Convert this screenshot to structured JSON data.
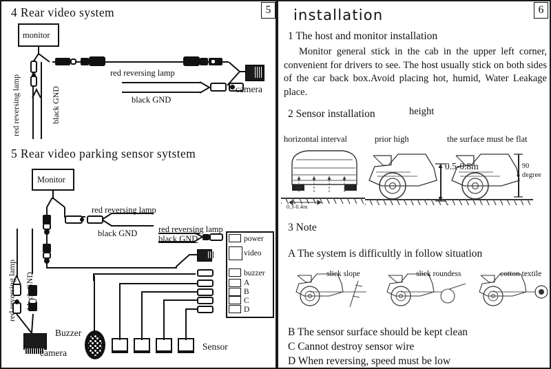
{
  "document": {
    "left_page_number": "5",
    "right_page_number": "6"
  },
  "left_panel": {
    "section4": {
      "heading": "4  Rear  video   system",
      "monitor_label": "monitor",
      "camera_label": "camera",
      "wire_labels": {
        "red_reversing": "red   reversing lamp",
        "black_gnd": "black   GND",
        "vertical_red": "red reversing lamp",
        "vertical_black": "black   GND"
      }
    },
    "section5": {
      "heading": "5  Rear  video  parking  sensor  sytstem",
      "monitor_label": "Monitor",
      "camera_label": "camera",
      "buzzer_label": "Buzzer",
      "sensor_label": "Sensor",
      "wire_labels": {
        "red_reversing_1": "red   reversing lamp",
        "black_gnd_1": "black  GND",
        "red_reversing_2": "red   reversing lamp",
        "black_gnd_2": "black  GND",
        "vertical_red": "red   reversing lamp",
        "vertical_black": "black GND"
      },
      "connector_ports": [
        "power",
        "video",
        "buzzer",
        "A",
        "B",
        "C",
        "D"
      ]
    }
  },
  "right_panel": {
    "title": "installation",
    "step1": {
      "heading": "1  The  host and monitor  installation",
      "body": "Monitor general stick in the cab in the upper left corner, convenient for drivers to see. The host usually stick on both sides of  the car back box.Avoid placing hot, humid, Water Leakage place."
    },
    "step2": {
      "heading": "2  Sensor installation",
      "heading_extra": "height",
      "captions": [
        "horizontal  interval",
        "prior high",
        "the surface must be flat"
      ],
      "dim_spacing": "0.3-0.4m",
      "dim_height": "0.5-0.8m",
      "dim_angle_line1": "90",
      "dim_angle_line2": "degree"
    },
    "step3": {
      "heading": "3  Note",
      "note_a": "A  The system  is  difficultly  in follow  situation",
      "situation_captions": [
        "slick slope",
        "slick  roundess",
        "cotton textile"
      ],
      "note_b": "B  The sensor  surface should be kept clean",
      "note_c": "C  Cannot destroy sensor wire",
      "note_d": "D  When reversing, speed must be low"
    }
  }
}
